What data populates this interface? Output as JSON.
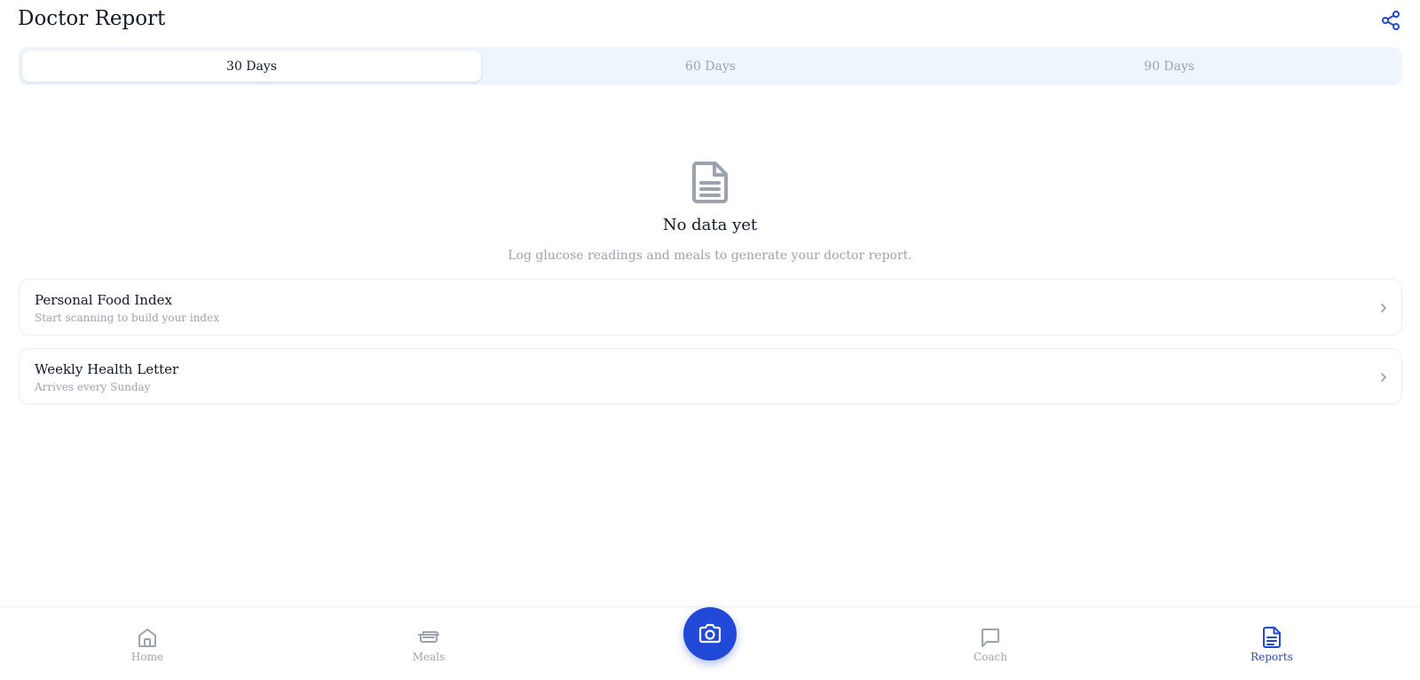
{
  "header": {
    "title": "Doctor Report",
    "share_icon": "share-icon"
  },
  "tabs": [
    {
      "label": "30 Days",
      "active": true
    },
    {
      "label": "60 Days",
      "active": false
    },
    {
      "label": "90 Days",
      "active": false
    }
  ],
  "empty_state": {
    "icon": "document-icon",
    "title": "No data yet",
    "message": "Log glucose readings and meals to generate your doctor report."
  },
  "cards": [
    {
      "title": "Personal Food Index",
      "subtitle": "Start scanning to build your index"
    },
    {
      "title": "Weekly Health Letter",
      "subtitle": "Arrives every Sunday"
    }
  ],
  "bottom_nav": {
    "items": [
      {
        "label": "Home",
        "icon": "home-icon",
        "active": false
      },
      {
        "label": "Meals",
        "icon": "bowl-icon",
        "active": false
      },
      {
        "label": "Coach",
        "icon": "chat-bubble-icon",
        "active": false
      },
      {
        "label": "Reports",
        "icon": "document-icon",
        "active": true
      }
    ],
    "camera_icon": "camera-icon"
  },
  "colors": {
    "accent": "#1f49d6",
    "active_nav": "#1e4bd1",
    "muted_text": "#9ca3af",
    "tab_track": "#eef5fd"
  }
}
